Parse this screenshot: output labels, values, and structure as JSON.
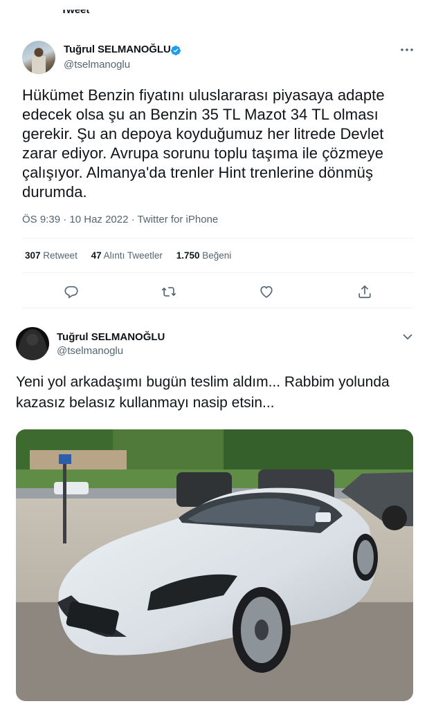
{
  "tweet1": {
    "name": "Tuğrul SELMANOĞLU",
    "handle": "@tselmanoglu",
    "text": "Hükümet Benzin fiyatını uluslararası piyasaya adapte edecek olsa şu an Benzin 35 TL Mazot 34 TL olması gerekir. Şu an depoya koyduğumuz her litrede Devlet zarar ediyor. Avrupa sorunu toplu taşıma ile çözmeye çalışıyor. Almanya'da trenler Hint trenlerine dönmüş durumda.",
    "time": "ÖS 9:39",
    "date": "10 Haz 2022",
    "source": "Twitter for iPhone",
    "stats": {
      "retweets_count": "307",
      "retweets_label": "Retweet",
      "quotes_count": "47",
      "quotes_label": "Alıntı Tweetler",
      "likes_count": "1.750",
      "likes_label": "Beğeni"
    }
  },
  "tweet2": {
    "name": "Tuğrul SELMANOĞLU",
    "handle": "@tselmanoglu",
    "text": "Yeni yol arkadaşımı bugün teslim aldım... Rabbim yolunda kazasız belasız kullanmayı nasip etsin..."
  },
  "icons": {
    "verified": "verified-badge-icon",
    "more": "more-icon",
    "reply": "reply-icon",
    "retweet": "retweet-icon",
    "like": "heart-icon",
    "share": "share-icon",
    "chevron": "chevron-down-icon"
  },
  "colors": {
    "verified": "#1d9bf0",
    "secondary_text": "#536471",
    "primary_text": "#0f1419",
    "divider": "#eff3f4"
  }
}
